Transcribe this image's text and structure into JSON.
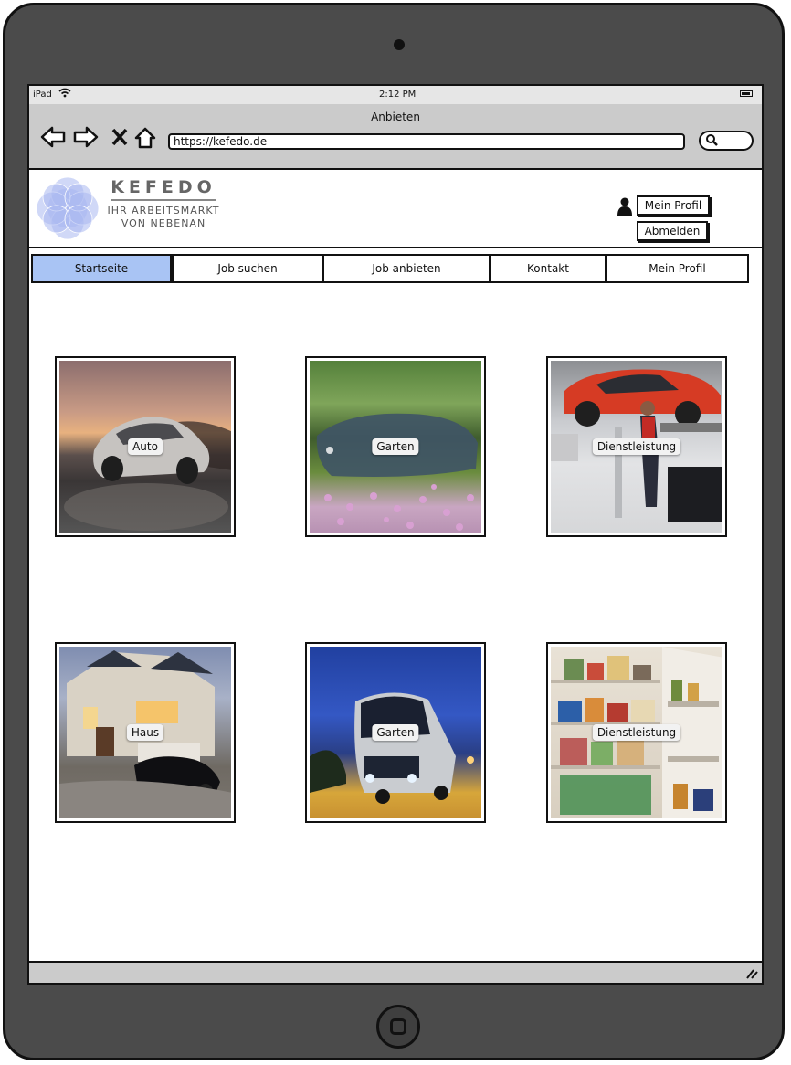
{
  "device": {
    "carrier": "iPad",
    "time": "2:12 PM"
  },
  "browser": {
    "title": "Anbieten",
    "url": "https://kefedo.de",
    "back_icon": "arrow-left-icon",
    "forward_icon": "arrow-right-icon",
    "close_icon": "close-icon",
    "home_icon": "home-icon",
    "search_icon": "search-icon"
  },
  "logo": {
    "name": "KEFEDO",
    "line1": "IHR ARBEITSMARKT",
    "line2": "VON NEBENAN",
    "color": "#a9b8f0"
  },
  "header": {
    "profile_button": "Mein Profil",
    "logout_button": "Abmelden",
    "user_icon": "user-icon"
  },
  "nav": {
    "active_color": "#a9c4f4",
    "tabs": [
      {
        "label": "Startseite"
      },
      {
        "label": "Job suchen"
      },
      {
        "label": "Job anbieten"
      },
      {
        "label": "Kontakt"
      },
      {
        "label": "Mein Profil"
      }
    ]
  },
  "tiles": [
    {
      "label": "Auto"
    },
    {
      "label": "Garten"
    },
    {
      "label": "Dienstleistung"
    },
    {
      "label": "Haus"
    },
    {
      "label": "Garten"
    },
    {
      "label": "Dienstleistung"
    }
  ]
}
